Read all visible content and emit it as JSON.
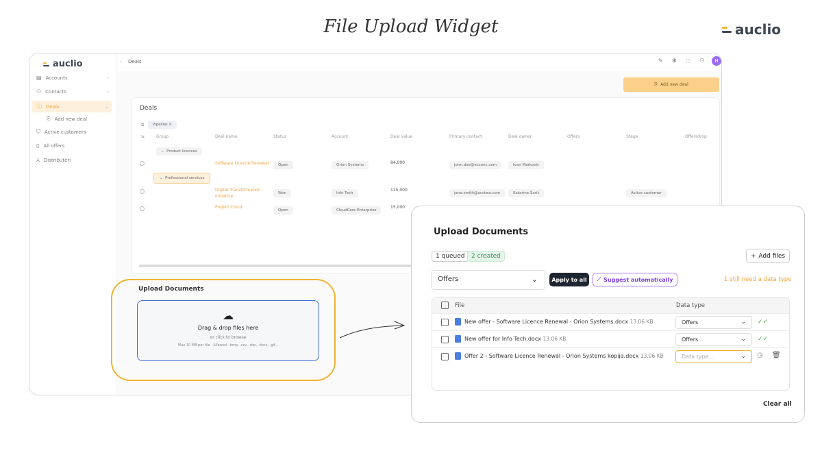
{
  "hero": {
    "title": "File Upload Widget",
    "brand": "auclio"
  },
  "app": {
    "logo": "auclio",
    "breadcrumb": "Deals",
    "sidebar": [
      {
        "label": "Accounts",
        "icon": "building-icon",
        "chevron": true
      },
      {
        "label": "Contacts",
        "icon": "contacts-icon",
        "chevron": true
      },
      {
        "label": "Deals",
        "icon": "deals-icon",
        "chevron": true,
        "active": true
      },
      {
        "label": "Add new deal",
        "icon": "add-deal-icon",
        "sub": true
      },
      {
        "label": "Active customers",
        "icon": "cart-icon"
      },
      {
        "label": "All offers",
        "icon": "file-icon"
      },
      {
        "label": "Distributeri",
        "icon": "tree-icon"
      }
    ],
    "add_deal_button": "Add new deal",
    "deals_title": "Deals",
    "filter_chip": "Pipeline",
    "columns": [
      "Group",
      "Deal name",
      "Status",
      "Account",
      "Deal value",
      "Primary contact",
      "Deal owner",
      "Offers",
      "Stage",
      "Offersdrop"
    ],
    "groups": [
      {
        "name": "Product licences",
        "rows": [
          {
            "deal": "Software Licence Renewal",
            "status": "Open",
            "account": "Orion Systems",
            "value": "84,000",
            "contact": "john.doe@ecconc.com",
            "owner": "Ivan Marković",
            "stage": ""
          }
        ]
      },
      {
        "name": "Professional services",
        "rows": [
          {
            "deal": "Digital Transformation Initiative",
            "status": "Won",
            "account": "Info Tech",
            "value": "115,000",
            "contact": "jane.smith@acctwo.com",
            "owner": "Katarina Šarić",
            "stage": "Active customer"
          },
          {
            "deal": "Project Cloud",
            "status": "Open",
            "account": "CloudCore Enterprise",
            "value": "15,000",
            "contact": "",
            "owner": "",
            "stage": ""
          }
        ]
      }
    ],
    "upload_small": {
      "title": "Upload Documents",
      "drag": "Drag & drop files here",
      "browse": "or click to browse",
      "limits": "Max 10 MB per file · Allowed: .bmp, .csv, .doc, .docx, .gif..."
    }
  },
  "panel": {
    "title": "Upload Documents",
    "queued": "1 queued",
    "created": "2 created",
    "add_files": "Add files",
    "type_select": "Offers",
    "apply_all": "Apply to all",
    "suggest": "Suggest automatically",
    "warning": "1 still need a data type",
    "col_file": "File",
    "col_type": "Data type",
    "files": [
      {
        "name": "New offer - Software Licence Renewal - Orion Systems.docx",
        "size": "13.06 KB",
        "type": "Offers",
        "placeholder": "",
        "state": "created"
      },
      {
        "name": "New offer for Info Tech.docx",
        "size": "13.06 KB",
        "type": "Offers",
        "placeholder": "",
        "state": "created"
      },
      {
        "name": "Offer 2 - Software Licence Renewal - Orion Systems kopija.docx",
        "size": "13.06 KB",
        "type": "",
        "placeholder": "Data type...",
        "state": "queued"
      }
    ],
    "clear_all": "Clear all"
  },
  "colors": {
    "accent": "#f2b32e",
    "link": "#f2a23a",
    "dropzone_border": "#3b6fd6",
    "purple": "#8a3ffc",
    "green": "#4caf50"
  }
}
